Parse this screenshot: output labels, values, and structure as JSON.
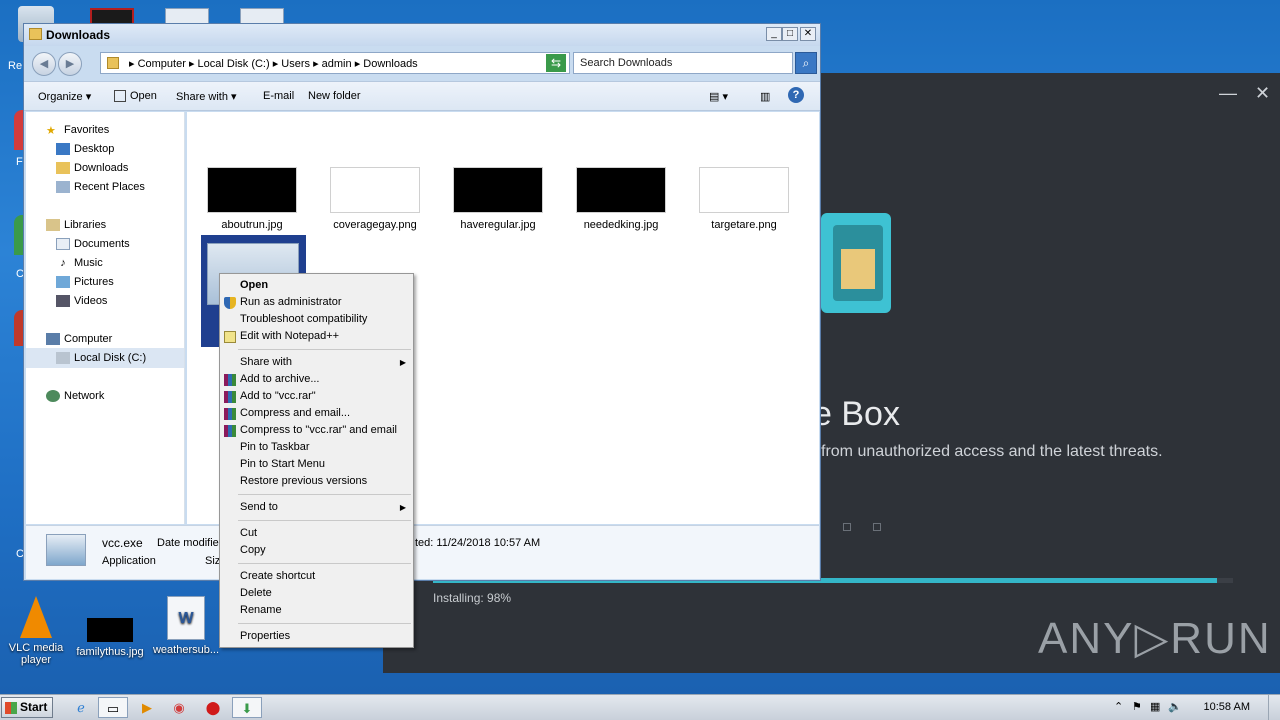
{
  "desktop": {
    "icons": [
      {
        "label": "VLC media player"
      },
      {
        "label": "familythus.jpg"
      },
      {
        "label": "weathersub..."
      }
    ],
    "partial_labels": [
      "Re",
      "F",
      "C",
      "C"
    ]
  },
  "installer": {
    "heading": "e Box",
    "subtitle": "from unauthorized access and the latest threats.",
    "status": "Installing: 98%",
    "progress": 0.98,
    "logo": "ANY▷RUN",
    "minimize": "—",
    "close": "✕"
  },
  "explorer": {
    "title": "Downloads",
    "address": {
      "crumbs": [
        "Computer",
        "Local Disk (C:)",
        "Users",
        "admin",
        "Downloads"
      ]
    },
    "search_placeholder": "Search Downloads",
    "toolbar": {
      "organize": "Organize",
      "open": "Open",
      "share_with": "Share with",
      "email": "E-mail",
      "new_folder": "New folder"
    },
    "nav": {
      "favorites": "Favorites",
      "desktop": "Desktop",
      "downloads": "Downloads",
      "recent": "Recent Places",
      "libraries": "Libraries",
      "documents": "Documents",
      "music": "Music",
      "pictures": "Pictures",
      "videos": "Videos",
      "computer": "Computer",
      "local_disk": "Local Disk (C:)",
      "network": "Network"
    },
    "files": [
      {
        "name": "aboutrun.jpg"
      },
      {
        "name": "coveragegay.png"
      },
      {
        "name": "haveregular.jpg"
      },
      {
        "name": "neededking.jpg"
      },
      {
        "name": "targetare.png"
      }
    ],
    "details": {
      "name": "vcc.exe",
      "type": "Application",
      "date_modified_label": "Date modifie",
      "size_label": "Siz",
      "created": "ted: 11/24/2018 10:57 AM"
    }
  },
  "context_menu": {
    "items": [
      "Open",
      "Run as administrator",
      "Troubleshoot compatibility",
      "Edit with Notepad++",
      "Share with",
      "Add to archive...",
      "Add to \"vcc.rar\"",
      "Compress and email...",
      "Compress to \"vcc.rar\" and email",
      "Pin to Taskbar",
      "Pin to Start Menu",
      "Restore previous versions",
      "Send to",
      "Cut",
      "Copy",
      "Create shortcut",
      "Delete",
      "Rename",
      "Properties"
    ]
  },
  "taskbar": {
    "start": "Start",
    "clock": "10:58 AM"
  }
}
